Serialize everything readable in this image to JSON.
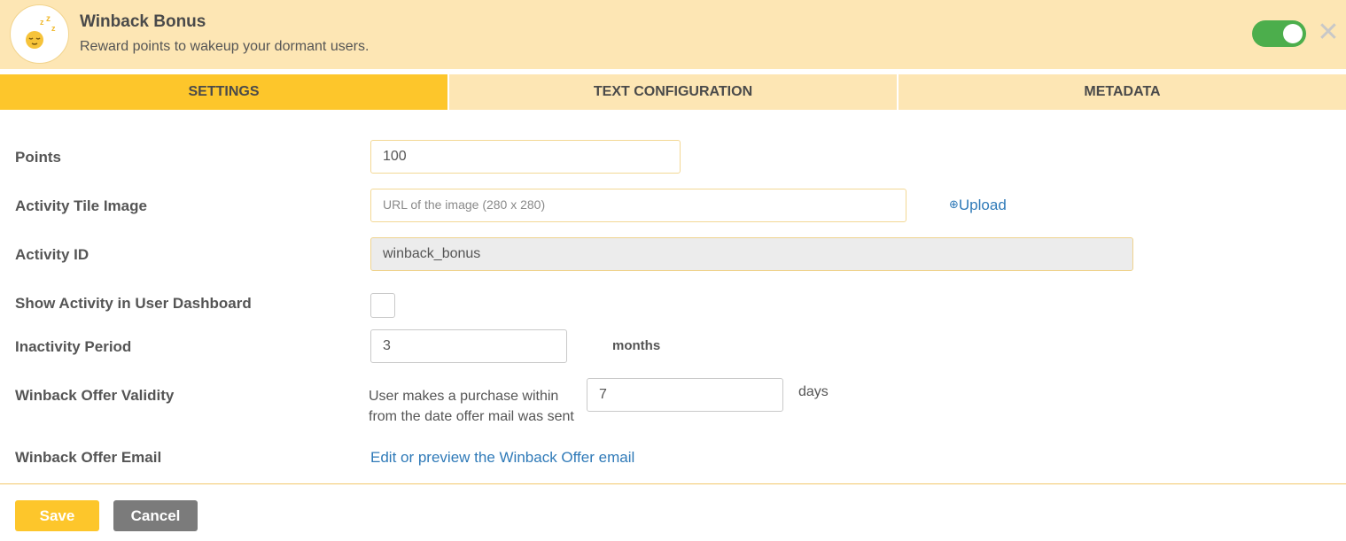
{
  "header": {
    "icon": "sleeping-face-icon",
    "title": "Winback Bonus",
    "subtitle": "Reward points to wakeup your dormant users.",
    "toggle_on": true,
    "colors": {
      "background": "#fde6b4",
      "toggle": "#4cae4c"
    }
  },
  "tabs": [
    {
      "label": "SETTINGS",
      "active": true
    },
    {
      "label": "TEXT CONFIGURATION",
      "active": false
    },
    {
      "label": "METADATA",
      "active": false
    }
  ],
  "form": {
    "points": {
      "label": "Points",
      "value": "100"
    },
    "tile_image": {
      "label": "Activity Tile Image",
      "placeholder": "URL of the image (280 x 280)",
      "upload_label": "Upload"
    },
    "activity_id": {
      "label": "Activity ID",
      "value": "winback_bonus"
    },
    "show_in_dashboard": {
      "label": "Show Activity in User Dashboard",
      "checked": false
    },
    "inactivity": {
      "label": "Inactivity Period",
      "value": "3",
      "unit": "months"
    },
    "validity": {
      "label": "Winback Offer Validity",
      "helper_line1": "User makes a purchase within",
      "helper_line2": "from the date offer mail was sent",
      "value": "7",
      "unit": "days"
    },
    "email": {
      "label": "Winback Offer Email",
      "link": "Edit or preview the Winback Offer email"
    }
  },
  "footer": {
    "save_label": "Save",
    "cancel_label": "Cancel",
    "colors": {
      "save": "#fdc62b",
      "cancel": "#7b7b7b"
    }
  }
}
